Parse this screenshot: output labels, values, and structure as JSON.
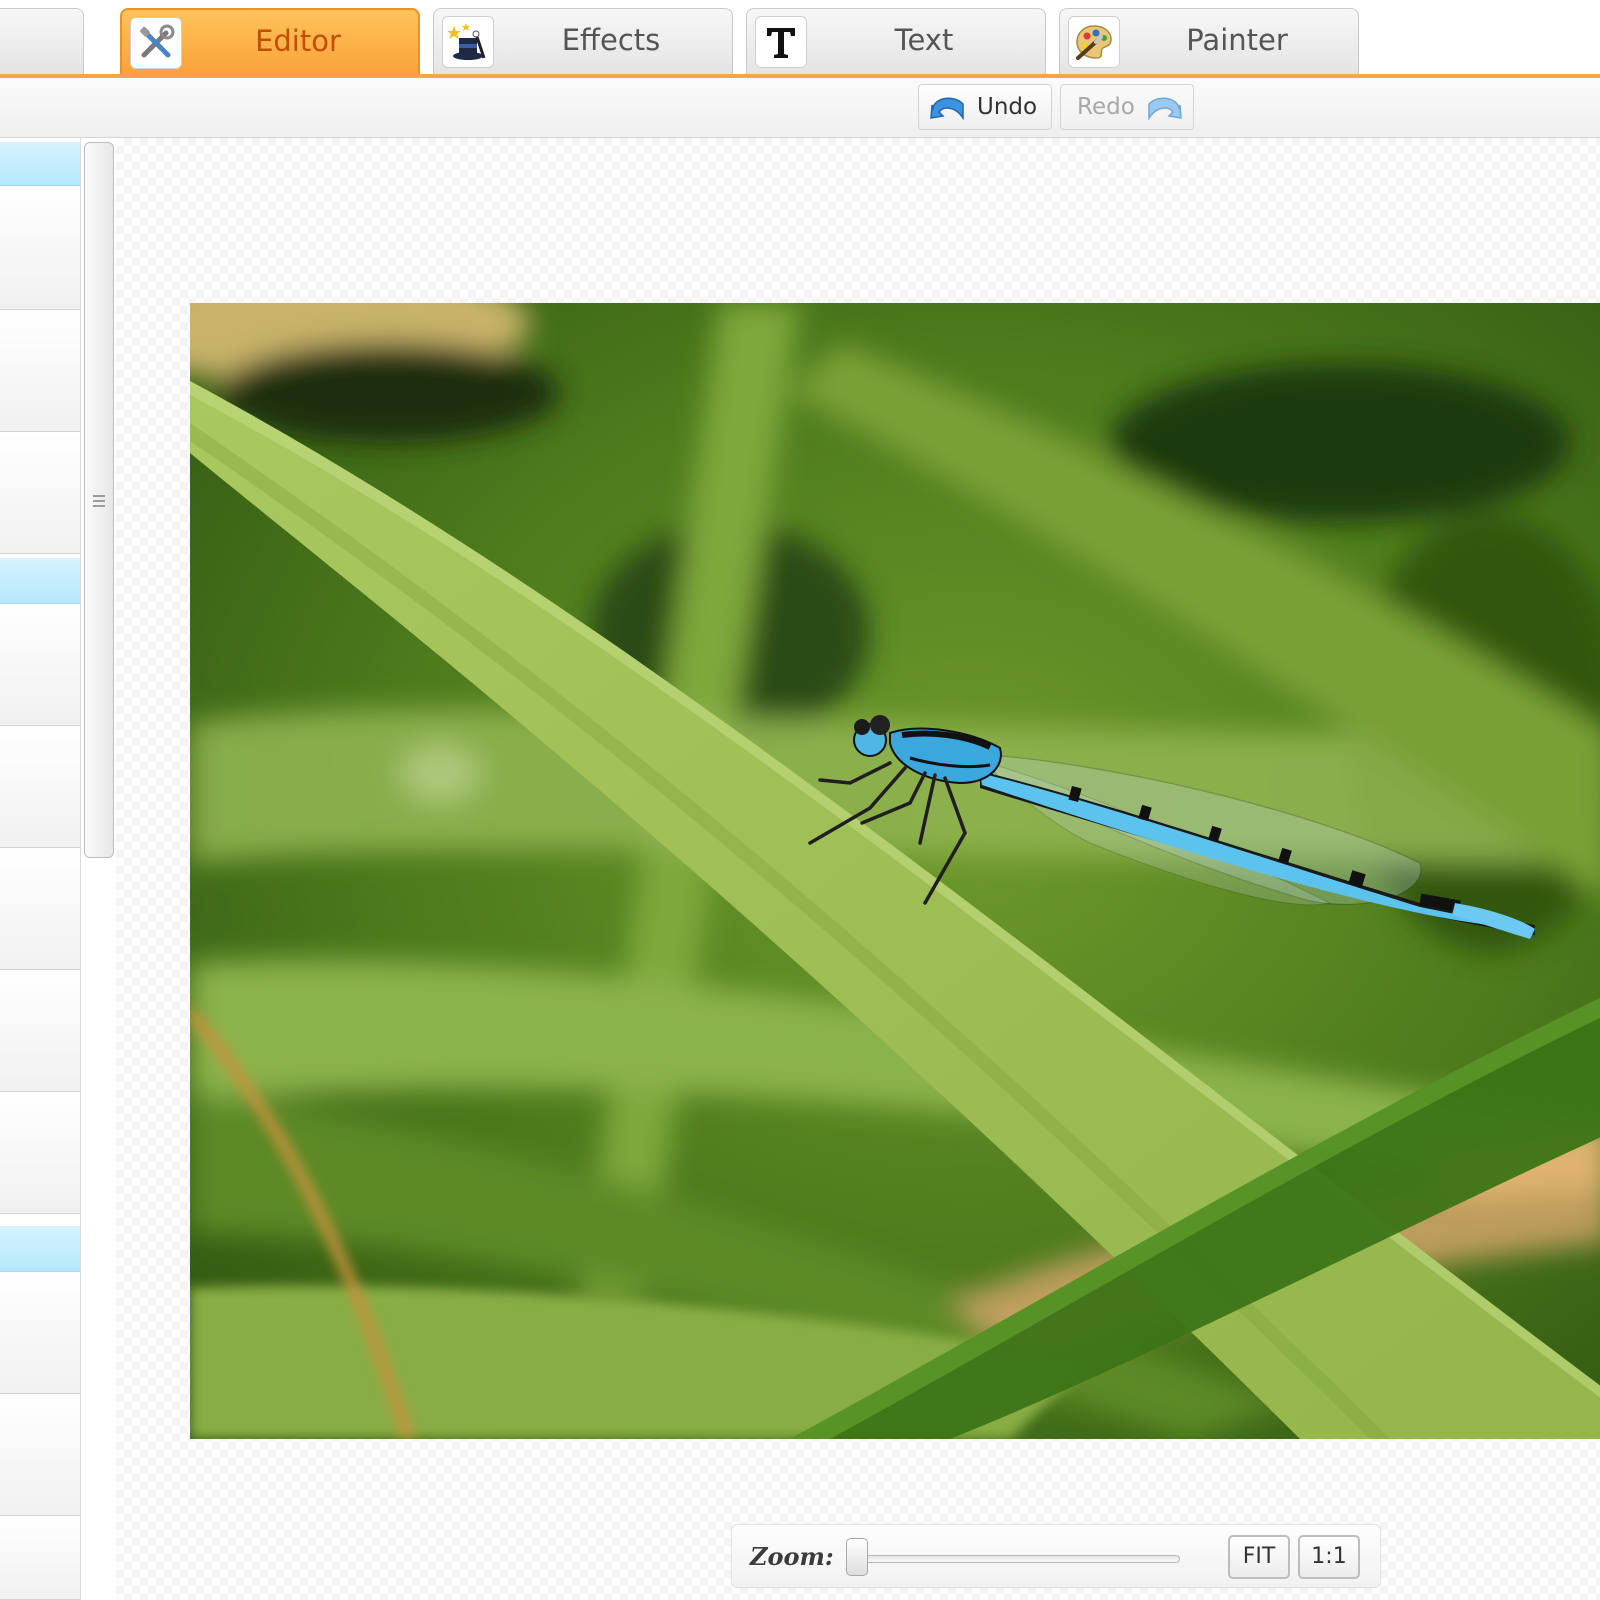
{
  "tabs": [
    {
      "id": "editor",
      "label": "Editor",
      "icon": "tools-icon",
      "active": true
    },
    {
      "id": "effects",
      "label": "Effects",
      "icon": "magic-hat-icon",
      "active": false
    },
    {
      "id": "text",
      "label": "Text",
      "icon": "text-t-icon",
      "active": false
    },
    {
      "id": "painter",
      "label": "Painter",
      "icon": "palette-icon",
      "active": false
    }
  ],
  "toolbar": {
    "undo_label": "Undo",
    "redo_label": "Redo",
    "undo_icon": "undo-arrow-icon",
    "redo_icon": "redo-arrow-icon"
  },
  "canvas": {
    "photo_subject": "photo-image"
  },
  "zoom": {
    "label": "Zoom:",
    "level": 0,
    "fit_label": "FIT",
    "one_to_one_label": "1:1"
  },
  "colors": {
    "accent": "#f4a548",
    "active_tab_text": "#c24f00",
    "panel_header": "#b5e8fc"
  }
}
